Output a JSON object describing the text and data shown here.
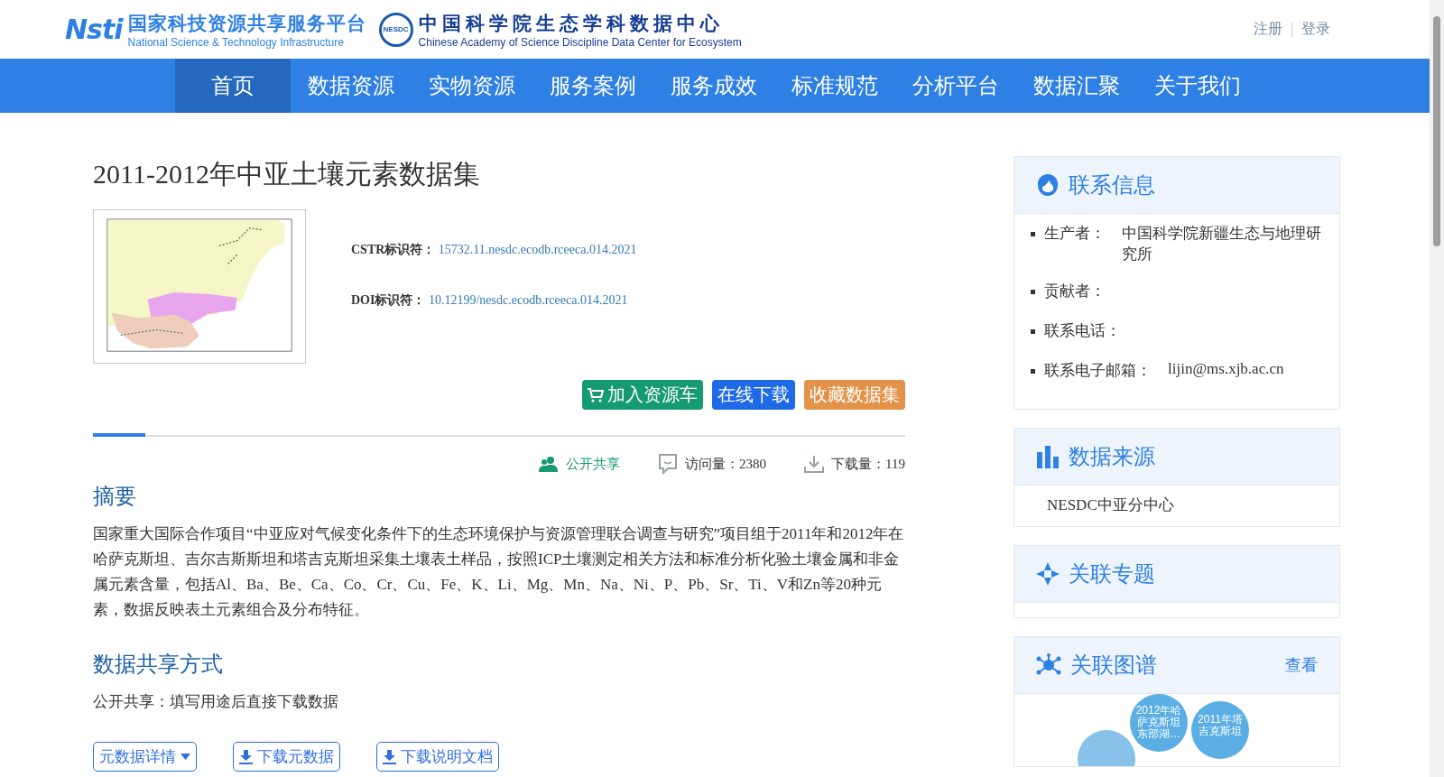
{
  "header": {
    "logos": [
      {
        "mark": "Nsti",
        "title": "国家科技资源共享服务平台",
        "subtitle": "National Science & Technology Infrastructure"
      },
      {
        "mark": "NESDC",
        "title": "中国科学院生态学科数据中心",
        "subtitle": "Chinese Academy of Science Discipline Data Center for Ecosystem"
      }
    ],
    "user_links": [
      "注册",
      "登录"
    ]
  },
  "nav": [
    {
      "label": "首页",
      "selected": true
    },
    {
      "label": "数据资源",
      "selected": false
    },
    {
      "label": "实物资源",
      "selected": false
    },
    {
      "label": "服务案例",
      "selected": false
    },
    {
      "label": "服务成效",
      "selected": false
    },
    {
      "label": "标准规范",
      "selected": false
    },
    {
      "label": "分析平台",
      "selected": false
    },
    {
      "label": "数据汇聚",
      "selected": false
    },
    {
      "label": "关于我们",
      "selected": false
    }
  ],
  "dataset": {
    "title": "2011-2012年中亚土壤元素数据集",
    "identifiers": [
      {
        "label": "CSTR标识符：",
        "value": "15732.11.nesdc.ecodb.rceeca.014.2021"
      },
      {
        "label": "DOI标识符：",
        "value": "10.12199/nesdc.ecodb.rceeca.014.2021"
      }
    ],
    "actions": [
      {
        "label": "加入资源车",
        "kind": "cart"
      },
      {
        "label": "在线下载",
        "kind": "download"
      },
      {
        "label": "收藏数据集",
        "kind": "favorite"
      }
    ],
    "stats": [
      {
        "kind": "sharing",
        "text": "公开共享"
      },
      {
        "kind": "visits",
        "text": "访问量：2380"
      },
      {
        "kind": "downloads",
        "text": "下载量：119"
      }
    ]
  },
  "sections": [
    {
      "heading": "摘要",
      "body": "国家重大国际合作项目“中亚应对气候变化条件下的生态环境保护与资源管理联合调查与研究”项目组于2011年和2012年在哈萨克斯坦、吉尔吉斯斯坦和塔吉克斯坦采集土壤表土样品，按照ICP土壤测定相关方法和标准分析化验土壤金属和非金属元素含量，包括Al、Ba、Be、Ca、Co、Cr、Cu、Fe、K、Li、Mg、Mn、Na、Ni、P、Pb、Sr、Ti、V和Zn等20种元素，数据反映表土元素组合及分布特征。"
    },
    {
      "heading": "数据共享方式",
      "body": "公开共享：填写用途后直接下载数据"
    }
  ],
  "bottom_buttons": [
    {
      "label": "元数据详情",
      "kind": "dropdown"
    },
    {
      "label": "下载元数据",
      "kind": "download"
    },
    {
      "label": "下载说明文档",
      "kind": "download"
    }
  ],
  "sidebar": [
    {
      "kind": "contact",
      "title": "联系信息",
      "items": [
        {
          "label": "生产者：",
          "value": "中国科学院新疆生态与地理研究所"
        },
        {
          "label": "贡献者："
        },
        {
          "label": "联系电话："
        },
        {
          "label": "联系电子邮箱：",
          "value": "lijin@ms.xjb.ac.cn"
        }
      ]
    },
    {
      "kind": "source",
      "title": "数据来源",
      "text": "NESDC中亚分中心"
    },
    {
      "kind": "topics",
      "title": "关联专题"
    },
    {
      "kind": "graph",
      "title": "关联图谱",
      "link": "查看",
      "nodes": [
        "2012年哈萨克斯坦东部湖…",
        "2011年塔吉克斯坦"
      ]
    }
  ]
}
